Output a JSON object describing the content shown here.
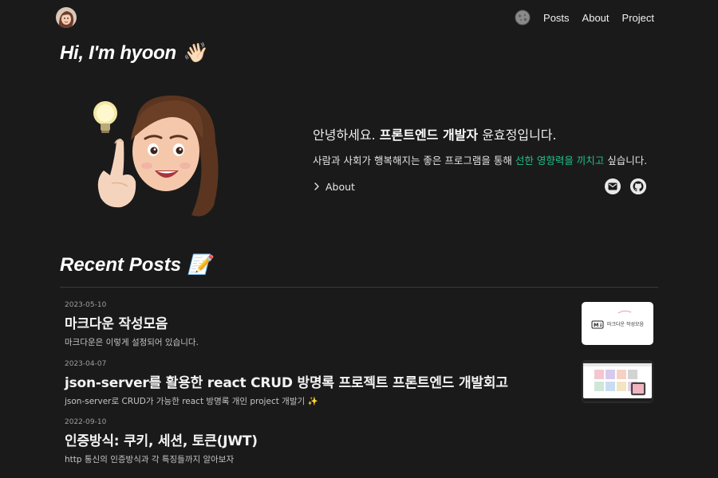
{
  "nav": {
    "links": [
      "Posts",
      "About",
      "Project"
    ],
    "theme_toggle_icon": "moon-face-icon",
    "avatar_icon": "memoji-avatar-icon"
  },
  "intro": {
    "hello": "Hi, I'm hyoon",
    "hello_emoji": "👋🏻",
    "greeting_prefix": "안녕하세요. ",
    "greeting_bold": "프론트엔드 개발자",
    "greeting_suffix": " 윤효정입니다.",
    "tagline_prefix": "사람과 사회가 행복해지는 좋은 프로그램을 통해 ",
    "tagline_accent": "선한 영향력을 끼치고",
    "tagline_suffix": " 싶습니다.",
    "about_label": "About",
    "social_icons": [
      "mail-icon",
      "github-icon"
    ],
    "accent_color": "#1fc08a"
  },
  "recent": {
    "title": "Recent Posts",
    "title_emoji": "📝",
    "posts": [
      {
        "date": "2023-05-10",
        "title": "마크다운 작성모음",
        "desc": "마크다운은 이렇게 설정되어 있습니다.",
        "thumb_text": "마크다운 작성모음"
      },
      {
        "date": "2023-04-07",
        "title": "json-server를 활용한 react CRUD 방명록 프로젝트 프론트엔드 개발회고",
        "desc": "json-server로 CRUD가 가능한 react 방명록 개인 project 개발기 ✨"
      },
      {
        "date": "2022-09-10",
        "title": "인증방식: 쿠키, 세션, 토큰(JWT)",
        "desc": "http 통신의 인증방식과 각 특징들까지 알아보자"
      }
    ]
  }
}
